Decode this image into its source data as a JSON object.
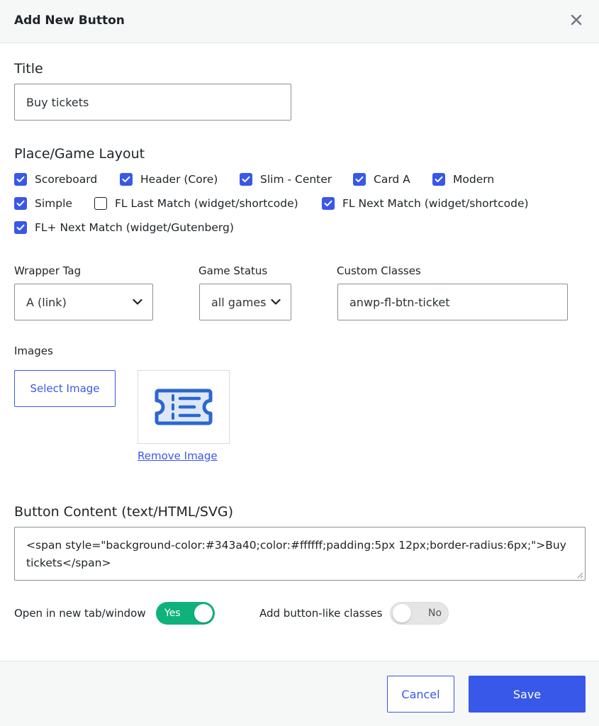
{
  "modal": {
    "title": "Add New Button"
  },
  "title_field": {
    "label": "Title",
    "value": "Buy tickets"
  },
  "layout": {
    "label": "Place/Game Layout",
    "options": [
      {
        "label": "Scoreboard",
        "checked": true
      },
      {
        "label": "Header (Core)",
        "checked": true
      },
      {
        "label": "Slim - Center",
        "checked": true
      },
      {
        "label": "Card A",
        "checked": true
      },
      {
        "label": "Modern",
        "checked": true
      },
      {
        "label": "Simple",
        "checked": true
      },
      {
        "label": "FL Last Match (widget/shortcode)",
        "checked": false
      },
      {
        "label": "FL Next Match (widget/shortcode)",
        "checked": true
      },
      {
        "label": "FL+ Next Match (widget/Gutenberg)",
        "checked": true
      }
    ]
  },
  "wrapper_tag": {
    "label": "Wrapper Tag",
    "value": "A (link)"
  },
  "game_status": {
    "label": "Game Status",
    "value": "all games"
  },
  "custom_classes": {
    "label": "Custom Classes",
    "value": "anwp-fl-btn-ticket"
  },
  "images": {
    "label": "Images",
    "select_label": "Select Image",
    "remove_label": "Remove Image",
    "preview_icon": "ticket-icon"
  },
  "button_content": {
    "label": "Button Content (text/HTML/SVG)",
    "value": "<span style=\"background-color:#343a40;color:#ffffff;padding:5px 12px;border-radius:6px;\">Buy tickets</span>"
  },
  "new_tab": {
    "label": "Open in new tab/window",
    "state": "Yes",
    "on": true
  },
  "button_classes": {
    "label": "Add button-like classes",
    "state": "No",
    "on": false
  },
  "footer": {
    "cancel_label": "Cancel",
    "save_label": "Save"
  },
  "colors": {
    "accent": "#3858e9",
    "toggle_on": "#0fb27a"
  }
}
